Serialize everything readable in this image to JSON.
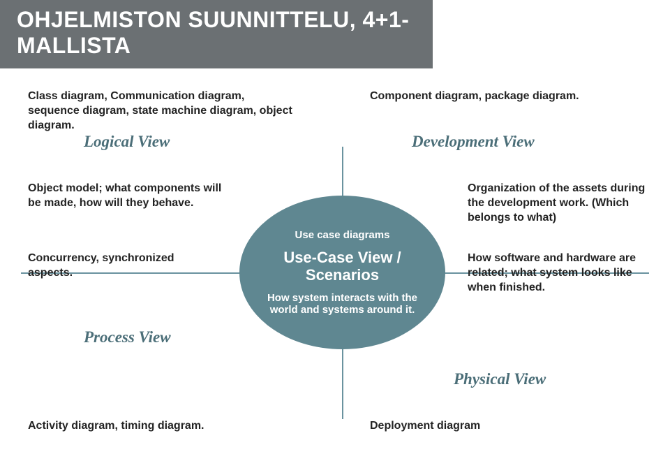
{
  "title": "OHJELMISTON SUUNNITTELU, 4+1-MALLISTA",
  "top_left": {
    "desc1": "Class diagram, Communication diagram, sequence diagram, state machine diagram, object diagram.",
    "view": "Logical View",
    "desc2": "Object model; what components will be made, how will they behave.",
    "desc3": "Concurrency, synchronized aspects."
  },
  "top_right": {
    "desc1": "Component diagram, package diagram.",
    "view": "Development View",
    "desc2": "Organization of the assets during the development work. (Which belongs to what)",
    "desc3": "How software and hardware are related; what system looks like when finished."
  },
  "bottom_left": {
    "view": "Process View",
    "desc1": "Activity diagram, timing diagram."
  },
  "bottom_right": {
    "view": "Physical View",
    "desc1": "Deployment diagram"
  },
  "center": {
    "small_top": "Use case diagrams",
    "big": "Use-Case View / Scenarios",
    "small_bottom": "How system interacts with the world and systems around it."
  }
}
